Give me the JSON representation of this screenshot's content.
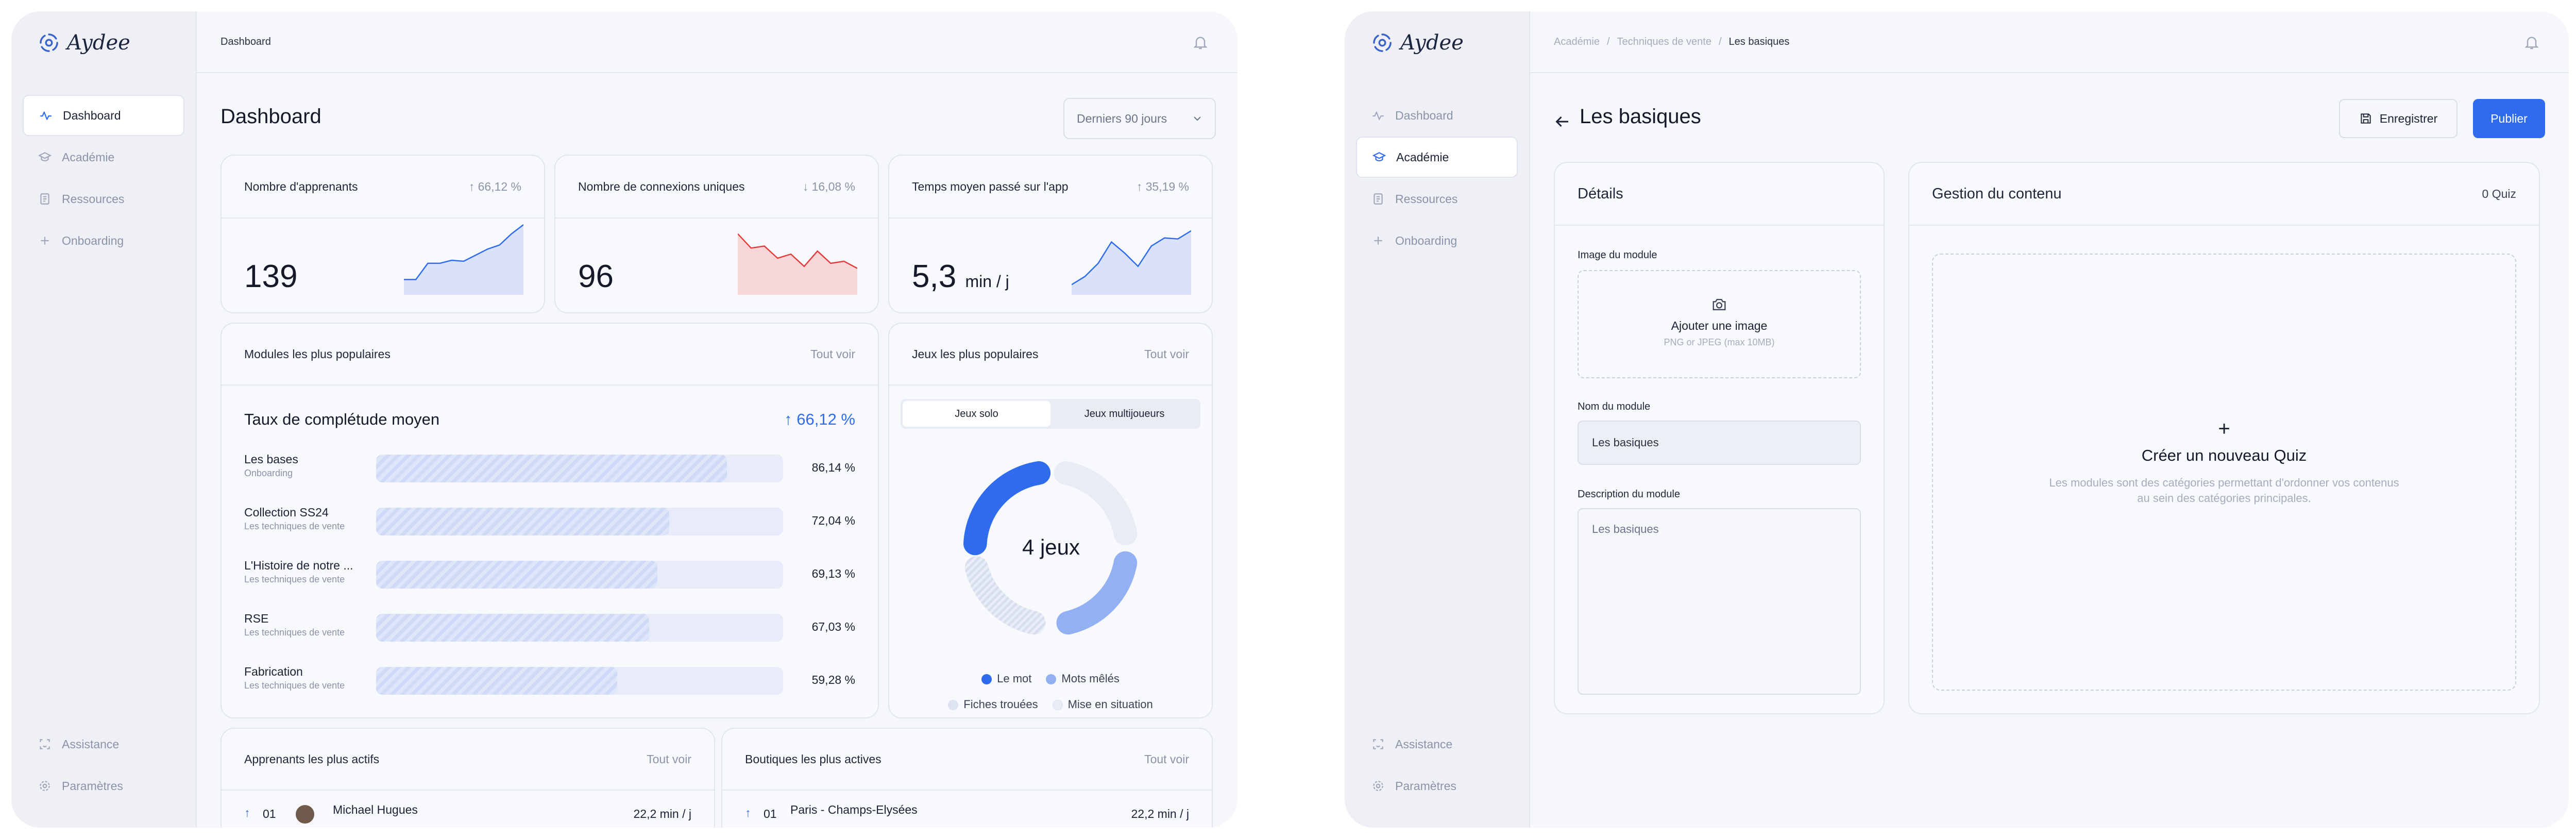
{
  "app": {
    "name": "Aydee"
  },
  "nav": {
    "dashboard": "Dashboard",
    "academie": "Académie",
    "ressources": "Ressources",
    "onboarding": "Onboarding",
    "assistance": "Assistance",
    "parametres": "Paramètres"
  },
  "dashboard": {
    "breadcrumb": "Dashboard",
    "title": "Dashboard",
    "period_select": "Derniers 90 jours",
    "kpis": [
      {
        "label": "Nombre d'apprenants",
        "change": "66,12 %",
        "trend": "up",
        "value": "139",
        "unit": "",
        "spark": [
          30,
          30,
          62,
          62,
          68,
          66,
          78,
          90,
          98,
          120,
          138
        ]
      },
      {
        "label": "Nombre de connexions uniques",
        "change": "16,08 %",
        "trend": "down",
        "value": "96",
        "unit": "",
        "spark": [
          120,
          92,
          96,
          72,
          80,
          56,
          86,
          62,
          66,
          52
        ]
      },
      {
        "label": "Temps moyen passé sur l'app",
        "change": "35,19 %",
        "trend": "up",
        "value": "5,3",
        "unit": "min / j",
        "spark": [
          20,
          36,
          62,
          104,
          82,
          56,
          96,
          112,
          110,
          126
        ]
      }
    ],
    "modules": {
      "title": "Modules les plus populaires",
      "see_all": "Tout voir",
      "subtitle": "Taux de complétude moyen",
      "change": "66,12 %",
      "items": [
        {
          "name": "Les bases",
          "category": "Onboarding",
          "pct": 86.14,
          "value": "86,14 %"
        },
        {
          "name": "Collection SS24",
          "category": "Les techniques de vente",
          "pct": 72.04,
          "value": "72,04 %"
        },
        {
          "name": "L'Histoire de notre ...",
          "category": "Les techniques de vente",
          "pct": 69.13,
          "value": "69,13 %"
        },
        {
          "name": "RSE",
          "category": "Les techniques de vente",
          "pct": 67.03,
          "value": "67,03 %"
        },
        {
          "name": "Fabrication",
          "category": "Les techniques de vente",
          "pct": 59.28,
          "value": "59,28 %"
        }
      ]
    },
    "games": {
      "title": "Jeux les plus populaires",
      "see_all": "Tout voir",
      "tab_solo": "Jeux solo",
      "tab_multi": "Jeux multijoueurs",
      "center": "4 jeux",
      "legend": [
        {
          "label": "Le mot",
          "color": "#2f6bed"
        },
        {
          "label": "Mots mêlés",
          "color": "#93b1f2"
        },
        {
          "label": "Fiches trouées",
          "color": "#dde3f1"
        },
        {
          "label": "Mise en situation",
          "color": "#e8ecf5"
        }
      ]
    },
    "learners": {
      "title": "Apprenants les plus actifs",
      "see_all": "Tout voir",
      "rank": "01",
      "name": "Michael Hugues",
      "value": "22,2 min / j"
    },
    "shops": {
      "title": "Boutiques les plus actives",
      "see_all": "Tout voir",
      "rank": "01",
      "name": "Paris - Champs-Elysées",
      "value": "22,2 min / j"
    }
  },
  "editor": {
    "breadcrumb": {
      "a": "Académie",
      "b": "Techniques de vente",
      "c": "Les basiques"
    },
    "title": "Les basiques",
    "save": "Enregistrer",
    "publish": "Publier",
    "details": {
      "title": "Détails",
      "image_label": "Image du module",
      "image_add": "Ajouter une image",
      "image_hint": "PNG or JPEG (max 10MB)",
      "name_label": "Nom du module",
      "name_value": "Les basiques",
      "desc_label": "Description du module",
      "desc_value": "Les basiques"
    },
    "content": {
      "title": "Gestion du contenu",
      "count": "0 Quiz",
      "create_plus": "+",
      "create_title": "Créer un nouveau Quiz",
      "create_desc_1": "Les modules sont des catégories permettant d'ordonner vos contenus",
      "create_desc_2": "au sein des catégories principales."
    }
  },
  "colors": {
    "accent": "#2f6bed",
    "negative": "#e23b3b",
    "muted": "#8a93a8"
  }
}
